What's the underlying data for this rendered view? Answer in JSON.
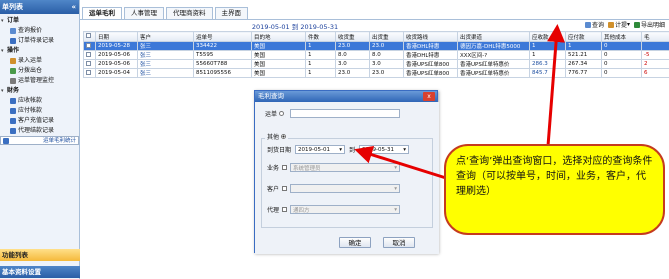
{
  "sidebar": {
    "title": "单列表",
    "collapse_icon": "«",
    "groups": [
      {
        "label": "订单",
        "items": [
          "查询报价",
          "订单待录记录"
        ]
      },
      {
        "label": "操作",
        "items": [
          "录入运单",
          "分拨出仓",
          "运单管理监控"
        ]
      },
      {
        "label": "财务",
        "items": [
          "应收帐款",
          "应付帐款",
          "客户充值记录",
          "代理结款记录",
          "运单毛利统计"
        ]
      }
    ],
    "bottom_1": "功能列表",
    "bottom_2": "基本资料设置"
  },
  "tabs": [
    "运单毛利",
    "人事管理",
    "代理商资料",
    "主界面"
  ],
  "period": "2019-05-01 到 2019-05-31",
  "toolbar": {
    "query": "查询",
    "calc": "计提",
    "export": "导出明细"
  },
  "grid": {
    "columns": [
      "日期",
      "客户",
      "运单号",
      "目的地",
      "件数",
      "收货重",
      "出货重",
      "收货路线",
      "出货渠道",
      "应收款",
      "应付款",
      "其他成本",
      "毛"
    ],
    "rows": [
      [
        "2019-05-28",
        "张三",
        "334422",
        "美国",
        "1",
        "23.0",
        "23.0",
        "香港DHL特惠",
        "德因万嘉-DHL特惠5000",
        "1",
        "1",
        "0",
        ""
      ],
      [
        "2019-05-06",
        "张三",
        "T5595",
        "美国",
        "1",
        "8.0",
        "8.0",
        "香港DHL特惠",
        "XXX区间-?",
        "1",
        "521.21",
        "0",
        "-5"
      ],
      [
        "2019-05-06",
        "张三",
        "55660T788",
        "美国",
        "1",
        "3.0",
        "3.0",
        "香港UPS红单800",
        "香港UPS红单特惠价",
        "286.3",
        "267.34",
        "0",
        "2"
      ],
      [
        "2019-05-04",
        "张三",
        "8511095556",
        "美国",
        "1",
        "23.0",
        "23.0",
        "香港UPS红单800",
        "香港UPS红单特惠价",
        "845.7",
        "776.77",
        "0",
        "6"
      ]
    ]
  },
  "modal": {
    "title": "毛利查询",
    "close": "x",
    "waybill_label": "运单",
    "other_label": "其他",
    "date_label": "到货日期",
    "date_from": "2019-05-01",
    "to_label": "到",
    "date_to": "2019-05-31",
    "business_label": "业务",
    "business_value": "系统管理员",
    "customer_label": "客户",
    "agent_label": "代理",
    "agent_value": "通四方",
    "ok": "确定",
    "cancel": "取消"
  },
  "callout": "点‘查询’弹出查询窗口，选择对应的查询条件查询（可以按单号，时间，业务，客户，代理刷选）",
  "colors": {
    "accent": "#3c78d8",
    "callout_bg": "#ffff00",
    "arrow": "#e60000"
  }
}
